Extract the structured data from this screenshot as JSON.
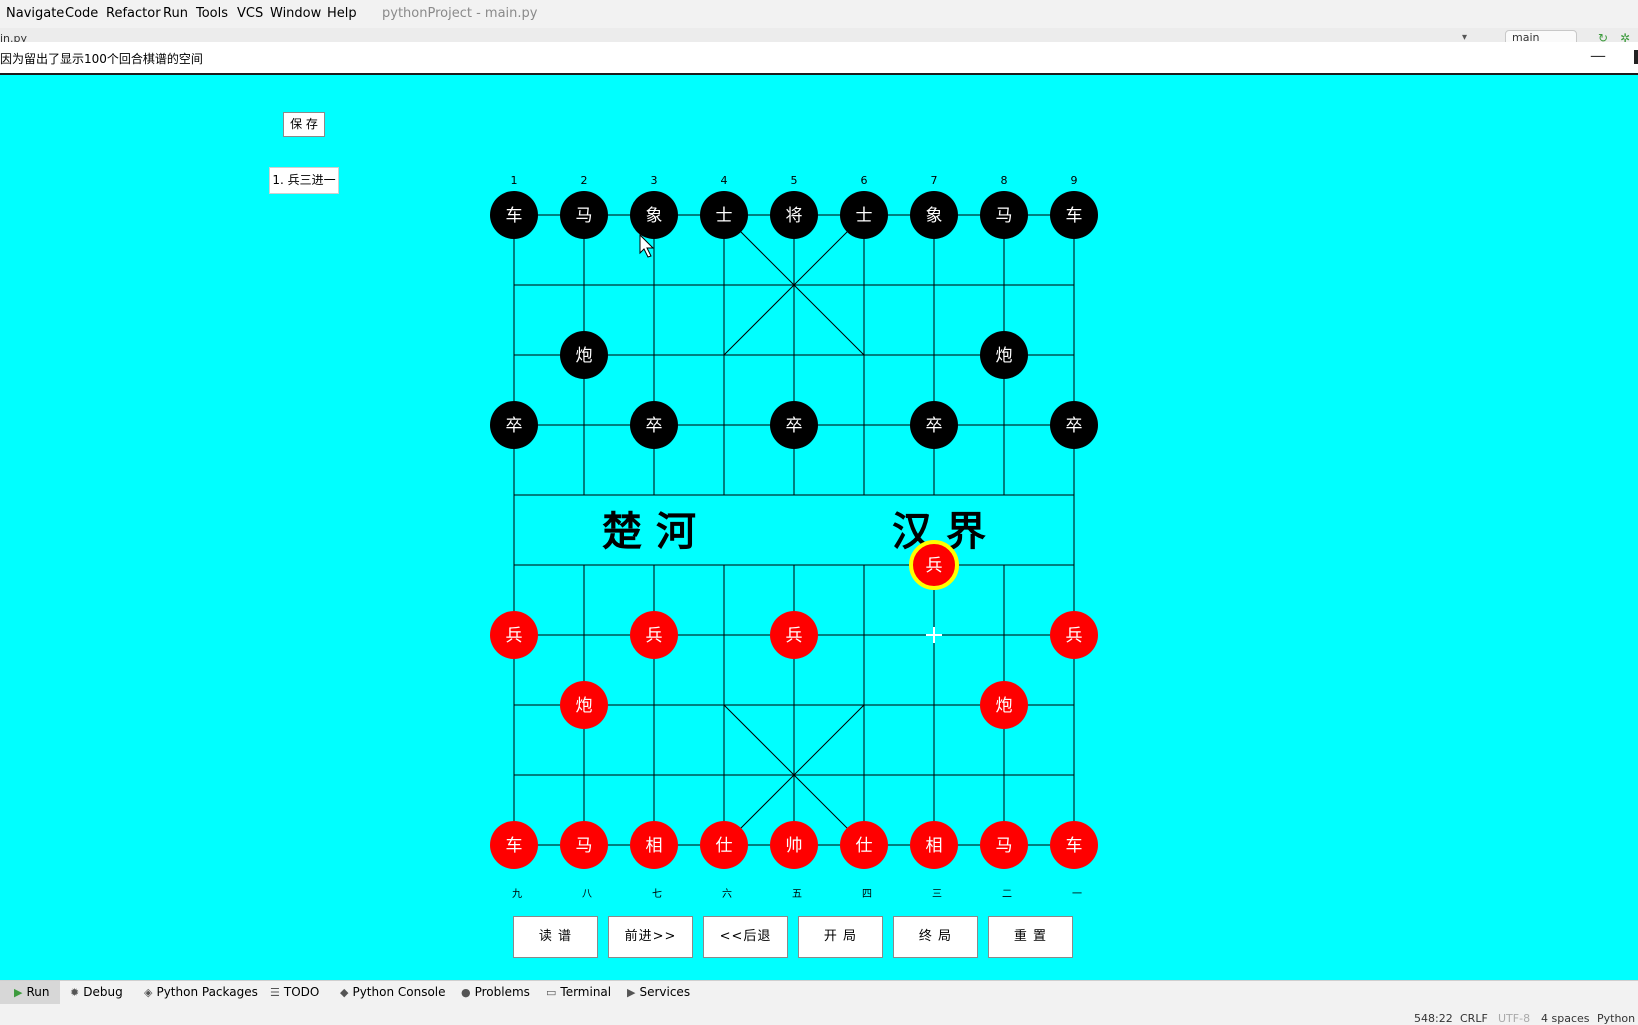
{
  "menu": {
    "items": [
      "Navigate",
      "Code",
      "Refactor",
      "Run",
      "Tools",
      "VCS",
      "Window",
      "Help"
    ],
    "project_title": "pythonProject - main.py"
  },
  "ide_subbar": {
    "file_tab": "in.py",
    "branch": "main"
  },
  "app_window": {
    "title": "因为留出了显示100个回合棋谱的空间",
    "minimize": "—"
  },
  "sidebar": {
    "save_label": "保 存",
    "moves": [
      "1. 兵三进一"
    ]
  },
  "board": {
    "top_numbers": [
      "1",
      "2",
      "3",
      "4",
      "5",
      "6",
      "7",
      "8",
      "9"
    ],
    "bottom_numbers": [
      "九",
      "八",
      "七",
      "六",
      "五",
      "四",
      "三",
      "二",
      "一"
    ],
    "river": {
      "left_text": "楚 河",
      "right_text": "汉 界"
    },
    "colors": {
      "background": "#00ffff",
      "black_piece": "#000000",
      "red_piece": "#ff0000",
      "selected_ring": "#ffff00",
      "line": "#000000"
    },
    "pieces": [
      {
        "label": "车",
        "side": "black",
        "file": 0,
        "rank": 0
      },
      {
        "label": "马",
        "side": "black",
        "file": 1,
        "rank": 0
      },
      {
        "label": "象",
        "side": "black",
        "file": 2,
        "rank": 0
      },
      {
        "label": "士",
        "side": "black",
        "file": 3,
        "rank": 0
      },
      {
        "label": "将",
        "side": "black",
        "file": 4,
        "rank": 0
      },
      {
        "label": "士",
        "side": "black",
        "file": 5,
        "rank": 0
      },
      {
        "label": "象",
        "side": "black",
        "file": 6,
        "rank": 0
      },
      {
        "label": "马",
        "side": "black",
        "file": 7,
        "rank": 0
      },
      {
        "label": "车",
        "side": "black",
        "file": 8,
        "rank": 0
      },
      {
        "label": "炮",
        "side": "black",
        "file": 1,
        "rank": 2
      },
      {
        "label": "炮",
        "side": "black",
        "file": 7,
        "rank": 2
      },
      {
        "label": "卒",
        "side": "black",
        "file": 0,
        "rank": 3
      },
      {
        "label": "卒",
        "side": "black",
        "file": 2,
        "rank": 3
      },
      {
        "label": "卒",
        "side": "black",
        "file": 4,
        "rank": 3
      },
      {
        "label": "卒",
        "side": "black",
        "file": 6,
        "rank": 3
      },
      {
        "label": "卒",
        "side": "black",
        "file": 8,
        "rank": 3
      },
      {
        "label": "兵",
        "side": "red",
        "file": 6,
        "rank": 5,
        "selected": true
      },
      {
        "label": "兵",
        "side": "red",
        "file": 0,
        "rank": 6
      },
      {
        "label": "兵",
        "side": "red",
        "file": 2,
        "rank": 6
      },
      {
        "label": "兵",
        "side": "red",
        "file": 4,
        "rank": 6
      },
      {
        "label": "兵",
        "side": "red",
        "file": 8,
        "rank": 6
      },
      {
        "label": "炮",
        "side": "red",
        "file": 1,
        "rank": 7
      },
      {
        "label": "炮",
        "side": "red",
        "file": 7,
        "rank": 7
      },
      {
        "label": "车",
        "side": "red",
        "file": 0,
        "rank": 9
      },
      {
        "label": "马",
        "side": "red",
        "file": 1,
        "rank": 9
      },
      {
        "label": "相",
        "side": "red",
        "file": 2,
        "rank": 9
      },
      {
        "label": "仕",
        "side": "red",
        "file": 3,
        "rank": 9
      },
      {
        "label": "帅",
        "side": "red",
        "file": 4,
        "rank": 9
      },
      {
        "label": "仕",
        "side": "red",
        "file": 5,
        "rank": 9
      },
      {
        "label": "相",
        "side": "red",
        "file": 6,
        "rank": 9
      },
      {
        "label": "马",
        "side": "red",
        "file": 7,
        "rank": 9
      },
      {
        "label": "车",
        "side": "red",
        "file": 8,
        "rank": 9
      }
    ]
  },
  "controls": {
    "read": "读 谱",
    "forward": "前进>>",
    "back": "<<后退",
    "opening": "开 局",
    "ending": "终 局",
    "reset": "重 置"
  },
  "toolwindows": [
    "Run",
    "Debug",
    "Python Packages",
    "TODO",
    "Python Console",
    "Problems",
    "Terminal",
    "Services"
  ],
  "status": {
    "position": "548:22",
    "line_sep": "CRLF",
    "encoding": "UTF-8",
    "indent": "4 spaces",
    "interpreter": "Python"
  }
}
